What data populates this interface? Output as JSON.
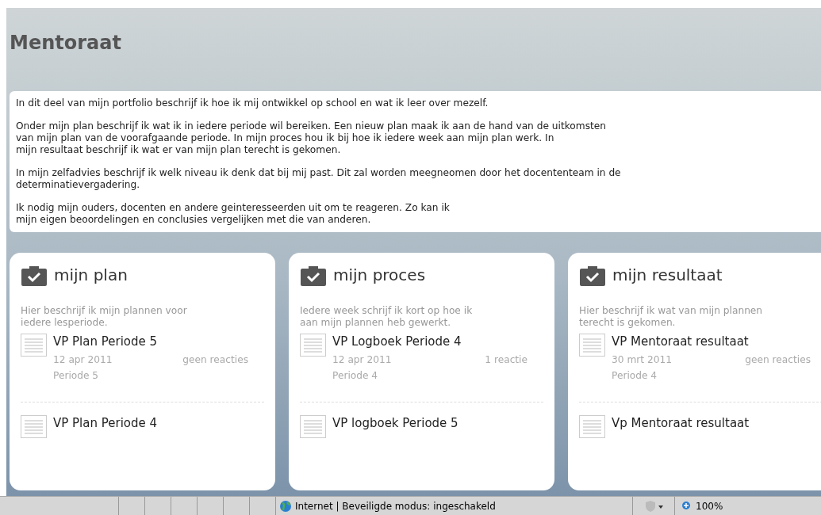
{
  "page": {
    "title": "Mentoraat"
  },
  "intro": [
    "In dit deel van mijn portfolio beschrijf ik hoe ik mij ontwikkel op school en wat ik leer over mezelf.",
    "Onder mijn plan beschrijf ik wat ik in iedere periode wil bereiken. Een nieuw plan maak ik aan de hand van de uitkomsten\nvan mijn plan van de voorafgaande periode. In mijn proces hou ik bij hoe ik iedere week aan mijn plan werk. In\nmijn resultaat beschrijf ik wat er van mijn plan terecht is gekomen.",
    "In mijn zelfadvies beschrijf ik welk niveau ik denk dat bij mij past. Dit zal worden meegneomen door het docententeam in de\ndeterminatievergadering.",
    "Ik nodig mijn ouders, docenten en andere geinteresseerden uit om te reageren. Zo kan ik\nmijn eigen beoordelingen en conclusies vergelijken met die van anderen."
  ],
  "cards": [
    {
      "title": "mijn plan",
      "description": "Hier beschrijf ik mijn plannen voor\niedere lesperiode.",
      "entries": [
        {
          "title": "VP Plan Periode 5",
          "date": "12 apr 2011",
          "reactions": "geen reacties",
          "period": "Periode 5"
        },
        {
          "title": "VP Plan Periode 4"
        }
      ]
    },
    {
      "title": "mijn proces",
      "description": "Iedere week schrijf ik kort op hoe ik\naan mijn plannen heb gewerkt.",
      "entries": [
        {
          "title": "VP Logboek Periode 4",
          "date": "12 apr 2011",
          "reactions": "1 reactie",
          "period": "Periode 4"
        },
        {
          "title": "VP logboek Periode 5"
        }
      ]
    },
    {
      "title": "mijn resultaat",
      "description": "Hier beschrijf ik wat van mijn plannen\nterecht is gekomen.",
      "entries": [
        {
          "title": "VP Mentoraat resultaat",
          "date": "30 mrt 2011",
          "reactions": "geen reacties",
          "period": "Periode 4"
        },
        {
          "title": "Vp Mentoraat resultaat"
        }
      ]
    }
  ],
  "status_bar": {
    "zone": "Internet | Beveiligde modus: ingeschakeld",
    "zoom": "100%"
  }
}
